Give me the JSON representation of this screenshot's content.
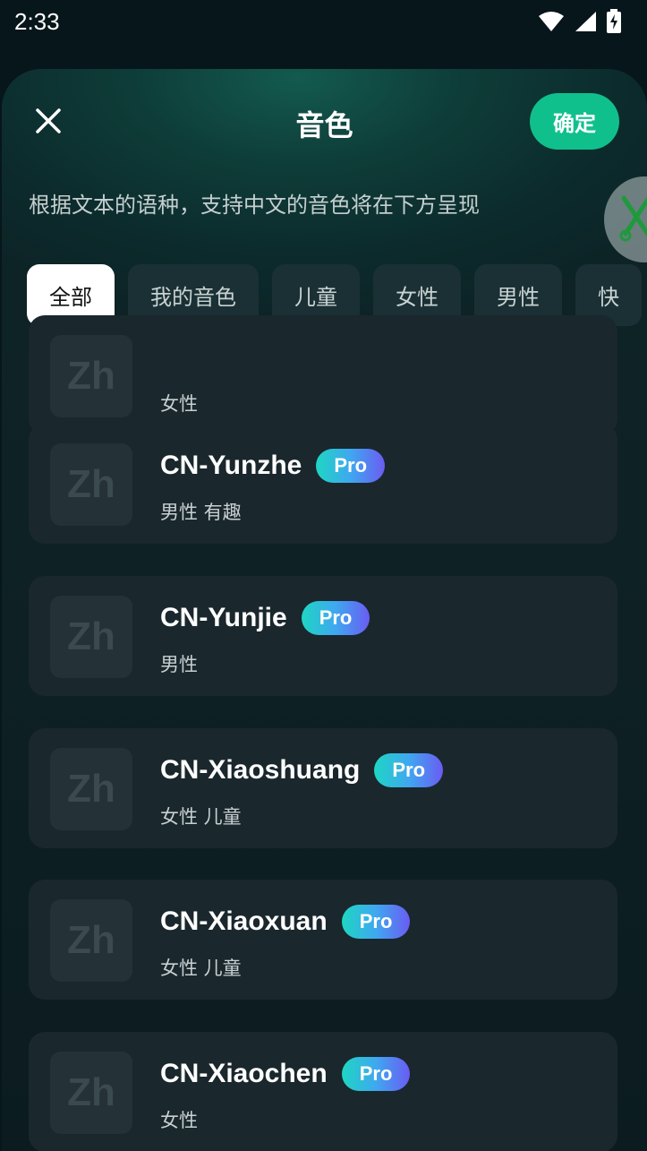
{
  "status_bar": {
    "time": "2:33"
  },
  "sheet": {
    "title": "音色",
    "confirm_label": "确定",
    "subtitle": "根据文本的语种，支持中文的音色将在下方呈现"
  },
  "filters": [
    {
      "label": "全部",
      "active": true
    },
    {
      "label": "我的音色",
      "active": false
    },
    {
      "label": "儿童",
      "active": false
    },
    {
      "label": "女性",
      "active": false
    },
    {
      "label": "男性",
      "active": false
    },
    {
      "label": "快",
      "active": false
    }
  ],
  "voices": [
    {
      "avatar": "Zh",
      "name": "",
      "badge": "",
      "tags": "女性"
    },
    {
      "avatar": "Zh",
      "name": "CN-Yunzhe",
      "badge": "Pro",
      "tags": "男性 有趣"
    },
    {
      "avatar": "Zh",
      "name": "CN-Yunjie",
      "badge": "Pro",
      "tags": "男性"
    },
    {
      "avatar": "Zh",
      "name": "CN-Xiaoshuang",
      "badge": "Pro",
      "tags": "女性 儿童"
    },
    {
      "avatar": "Zh",
      "name": "CN-Xiaoxuan",
      "badge": "Pro",
      "tags": "女性 儿童"
    },
    {
      "avatar": "Zh",
      "name": "CN-Xiaochen",
      "badge": "Pro",
      "tags": "女性"
    }
  ],
  "colors": {
    "accent": "#10c08c",
    "card_bg": "#1a272d",
    "badge_gradient": [
      "#1ed6c3",
      "#6a5cf2"
    ]
  },
  "icons": {
    "close": "close-icon",
    "tool": "wrench-screwdriver-icon",
    "wifi": "wifi-icon",
    "signal": "signal-icon",
    "battery": "battery-charging-icon"
  }
}
